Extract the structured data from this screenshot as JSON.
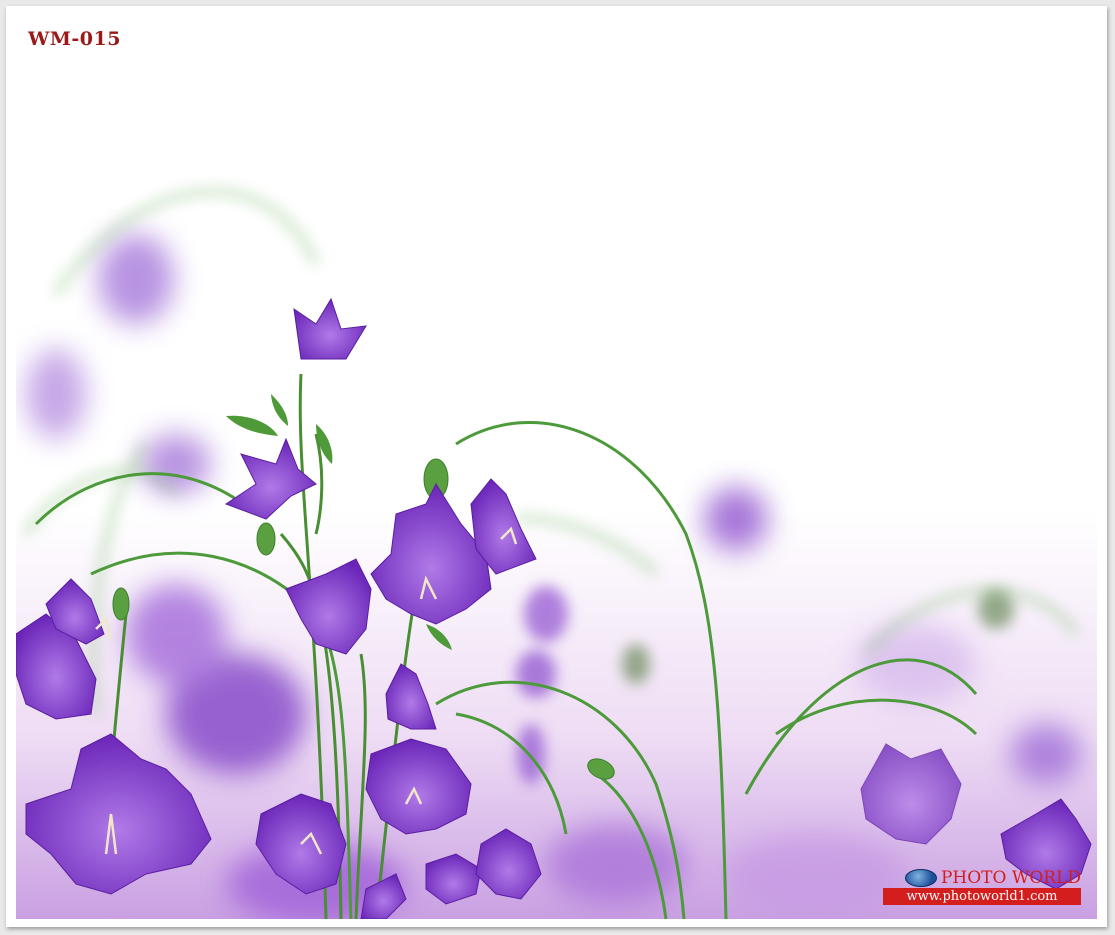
{
  "product_code": "WM-015",
  "watermark": {
    "brand": "PHOTO WORLD",
    "url": "www.photoworld1.com",
    "icon": "globe-icon"
  },
  "colors": {
    "petal": "#8a3fd6",
    "petal_dark": "#5b1fa8",
    "stem": "#3f8a2a",
    "code_text": "#9a1a1a",
    "watermark_red": "#d41d1d"
  }
}
